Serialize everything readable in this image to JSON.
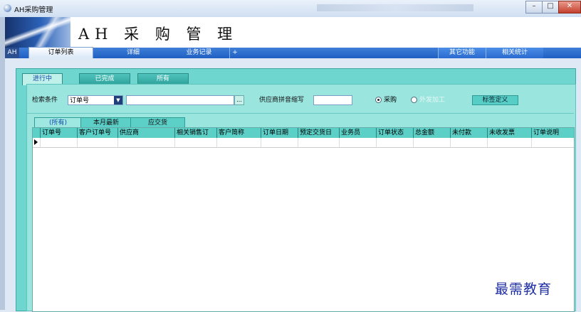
{
  "window": {
    "title": "AH采购管理"
  },
  "banner": {
    "title": "AH 采 购 管 理"
  },
  "menubar": {
    "ah_label": "AH",
    "items": [
      "订单列表",
      "详细",
      "业务记录",
      "+"
    ],
    "right_items": [
      "其它功能",
      "相关统计"
    ]
  },
  "status_tabs": [
    "进行中",
    "已完成",
    "所有"
  ],
  "filter": {
    "label": "检索条件",
    "field_value": "订单号",
    "search_value": "",
    "ellipsis_label": "...",
    "supplier_label": "供应商拼音缩写",
    "supplier_value": "",
    "radio_purchase": "采购",
    "radio_outsource": "外发加工",
    "tag_button": "标签定义"
  },
  "period_tabs": [
    "(所有)",
    "本月最新",
    "应交货"
  ],
  "grid": {
    "columns": [
      "订单号",
      "客户订单号",
      "供应商",
      "相关销售订",
      "客户简称",
      "订单日期",
      "预定交货日",
      "业务员",
      "订单状态",
      "总金额",
      "未付款",
      "未收发票",
      "订单说明"
    ]
  },
  "watermark": "最需教育",
  "colors": {
    "menu_blue": "#1f5fc2",
    "panel_teal": "#6fd6cf",
    "active_tab_text": "#1448a8"
  }
}
